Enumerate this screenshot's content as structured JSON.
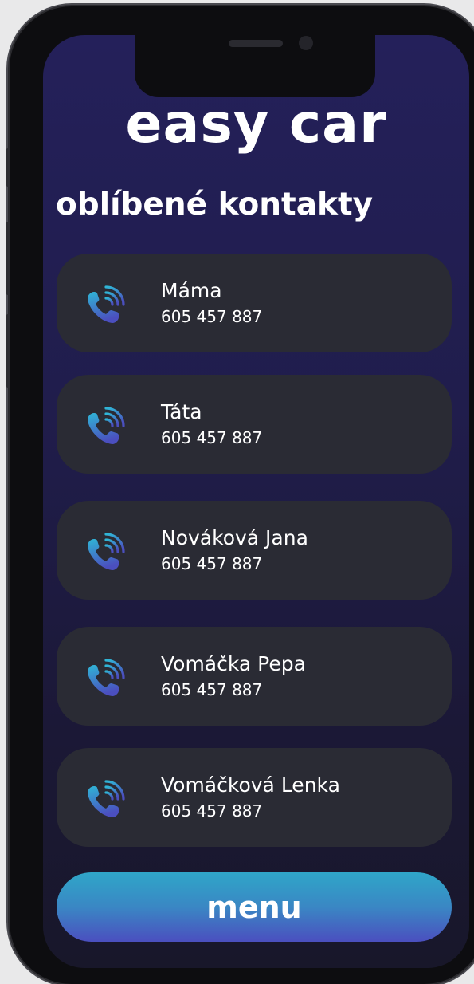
{
  "app": {
    "brand": "easy car",
    "section_title": "oblíbené kontakty"
  },
  "contacts": [
    {
      "name": "Máma",
      "phone": "605 457 887",
      "icon": "phone-call-icon"
    },
    {
      "name": "Táta",
      "phone": "605 457 887",
      "icon": "phone-call-icon"
    },
    {
      "name": "Nováková Jana",
      "phone": "605 457 887",
      "icon": "phone-call-icon"
    },
    {
      "name": "Vomáčka Pepa",
      "phone": "605 457 887",
      "icon": "phone-call-icon"
    },
    {
      "name": "Vomáčková Lenka",
      "phone": "605 457 887",
      "icon": "phone-call-icon"
    }
  ],
  "menu": {
    "label": "menu"
  },
  "colors": {
    "background_top": "#24205a",
    "background_bottom": "#18172a",
    "card": "#2a2b34",
    "icon_gradient_start": "#2fb6d6",
    "icon_gradient_end": "#4b4fbf",
    "menu_gradient_start": "#2fa6c8",
    "menu_gradient_end": "#4b4fbf"
  }
}
